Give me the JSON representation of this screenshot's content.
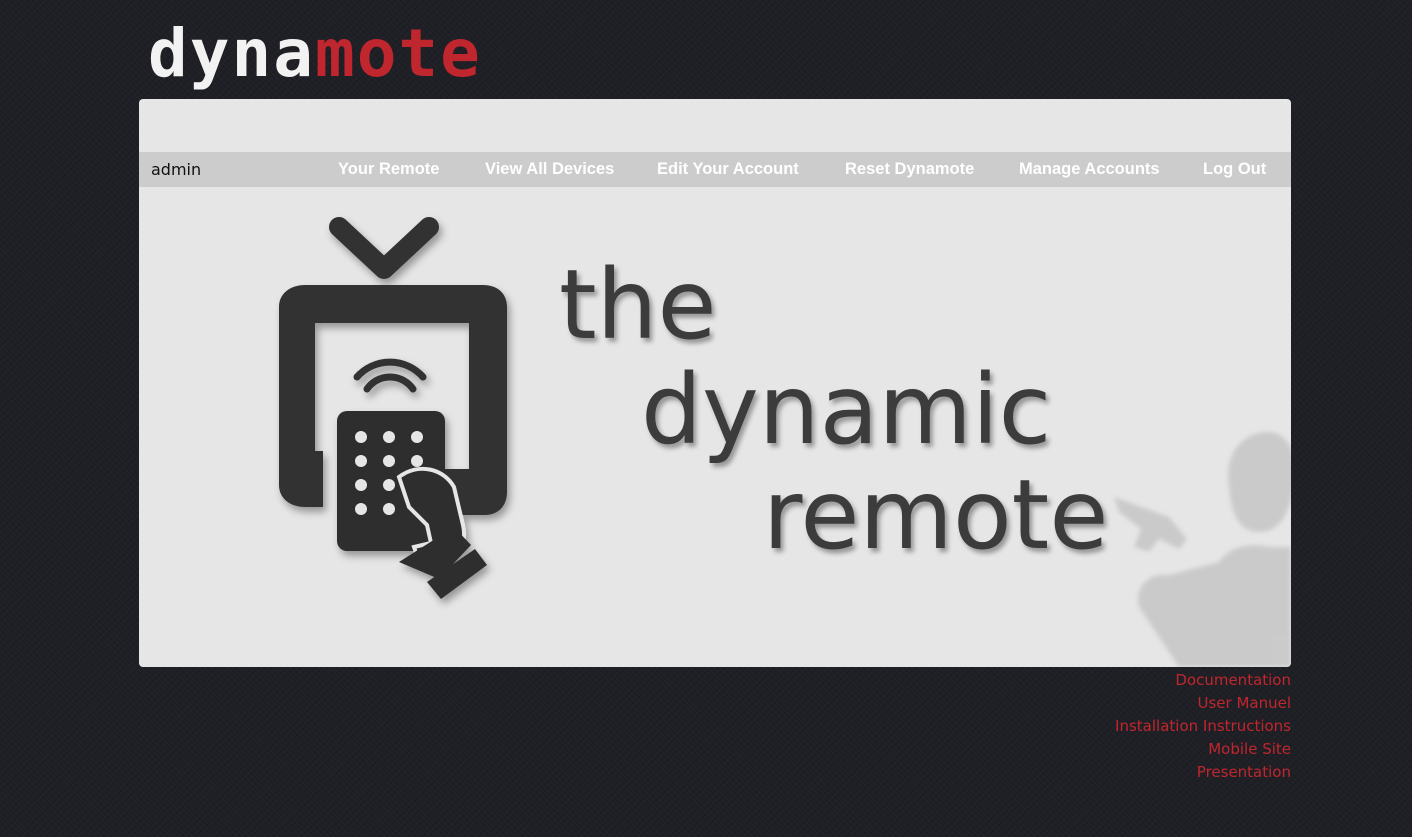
{
  "logo": {
    "part1": "dyna",
    "part2": "mote"
  },
  "nav": {
    "user": "admin",
    "links": [
      "Your Remote",
      "View All Devices",
      "Edit Your Account",
      "Reset Dynamote",
      "Manage Accounts",
      "Log Out"
    ]
  },
  "hero": {
    "line1": "the",
    "line2": "dynamic",
    "line3": "remote"
  },
  "footer": {
    "links": [
      "Documentation",
      "User Manuel",
      "Installation Instructions",
      "Mobile Site",
      "Presentation"
    ]
  },
  "colors": {
    "background": "#1f1f26",
    "accent": "#c0262d",
    "panel": "#e6e6e6",
    "navbar": "#cccccc"
  }
}
